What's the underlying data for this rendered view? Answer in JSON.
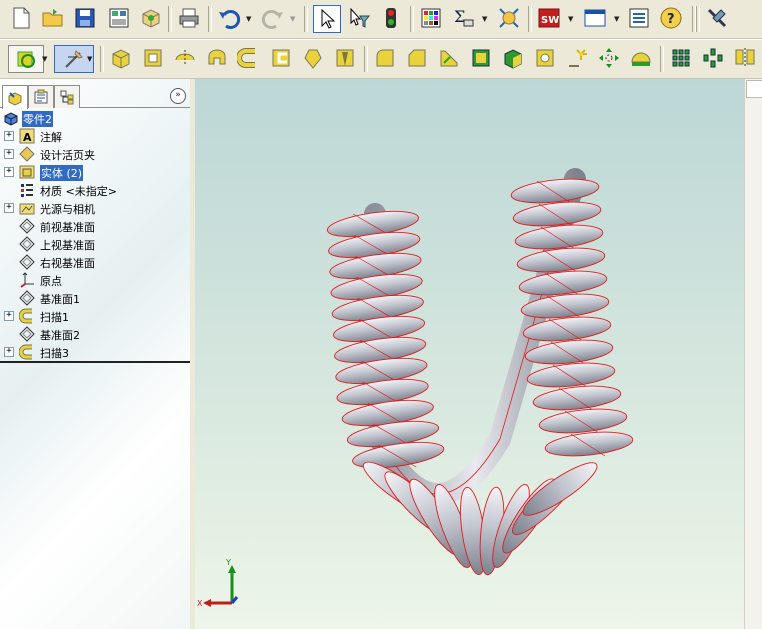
{
  "toolbar_top": {
    "buttons": [
      "new-document",
      "open-file",
      "save",
      "print-preview-layout",
      "options",
      "print",
      "undo",
      "redo",
      "select",
      "selection-filter",
      "rebuild",
      "color-palette",
      "sum-calculate",
      "view-orientation",
      "solidworks-menu",
      "window-layout",
      "properties-list",
      "help"
    ]
  },
  "toolbar_features": {
    "buttons": [
      "sketch",
      "smart-dimension",
      "extruded-boss",
      "revolved-boss",
      "swept-boss",
      "lofted-boss",
      "boundary-boss",
      "extruded-cut",
      "revolved-cut",
      "swept-cut",
      "lofted-cut",
      "fillet",
      "chamfer",
      "rib",
      "shell",
      "draft",
      "hole-wizard",
      "reference-geometry",
      "curves",
      "dome",
      "linear-pattern",
      "circular-pattern",
      "mirror"
    ]
  },
  "feature_tree": {
    "root": "零件2",
    "items": [
      {
        "label": "注解",
        "expandable": true,
        "icon": "annotation"
      },
      {
        "label": "设计活页夹",
        "expandable": true,
        "icon": "design-binder"
      },
      {
        "label": "实体 (2)",
        "expandable": true,
        "icon": "solid-bodies",
        "selected": true
      },
      {
        "label": "材质 <未指定>",
        "expandable": false,
        "icon": "material"
      },
      {
        "label": "光源与相机",
        "expandable": true,
        "icon": "lights-cameras"
      },
      {
        "label": "前视基准面",
        "expandable": false,
        "icon": "plane"
      },
      {
        "label": "上视基准面",
        "expandable": false,
        "icon": "plane"
      },
      {
        "label": "右视基准面",
        "expandable": false,
        "icon": "plane"
      },
      {
        "label": "原点",
        "expandable": false,
        "icon": "origin"
      },
      {
        "label": "基准面1",
        "expandable": false,
        "icon": "plane"
      },
      {
        "label": "扫描1",
        "expandable": true,
        "icon": "sweep"
      },
      {
        "label": "基准面2",
        "expandable": false,
        "icon": "plane"
      },
      {
        "label": "扫描3",
        "expandable": true,
        "icon": "sweep"
      }
    ]
  },
  "triad": {
    "x_label": "X",
    "y_label": "Y"
  },
  "colors": {
    "model_edge": "#e01b1b",
    "model_fill": "#b8bcc6",
    "selection": "#3169c6"
  }
}
